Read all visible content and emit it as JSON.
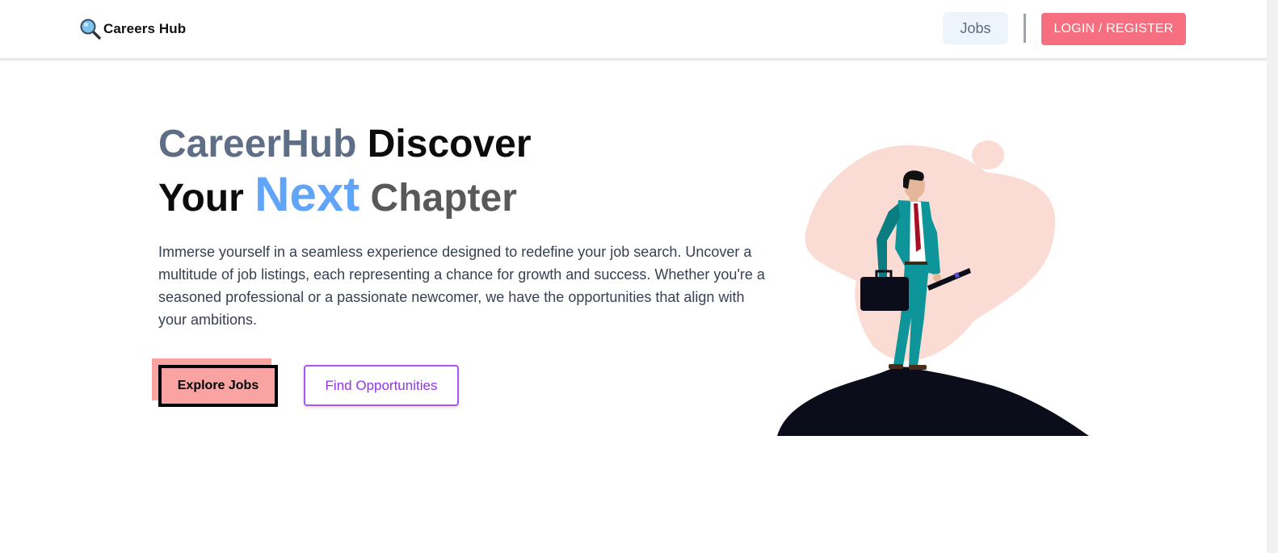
{
  "header": {
    "logo_text": "Careers Hub",
    "logo_icon": "magnifying-glass-icon",
    "nav": {
      "jobs_label": "Jobs",
      "login_label": "LOGIN / REGISTER"
    }
  },
  "hero": {
    "title": {
      "word1": "CareerHub",
      "word2": "Discover",
      "word3": "Your",
      "word4": "Next",
      "word5": "Chapter"
    },
    "description": "Immerse yourself in a seamless experience designed to redefine your job search. Uncover a multitude of job listings, each representing a chance for growth and success. Whether you're a seasoned professional or a passionate newcomer, we have the opportunities that align with your ambitions.",
    "buttons": {
      "explore_label": "Explore Jobs",
      "find_label": "Find Opportunities"
    },
    "illustration_icon": "businessman-on-hill-illustration"
  },
  "colors": {
    "accent_pink": "#f56f80",
    "explore_bg": "#f9a3a3",
    "find_border": "#a855f7",
    "title_slate": "#5e6e87",
    "title_blue": "#60a5fa",
    "blob": "#fadcd4",
    "suit": "#0e9599",
    "hill": "#0b0d1a"
  }
}
